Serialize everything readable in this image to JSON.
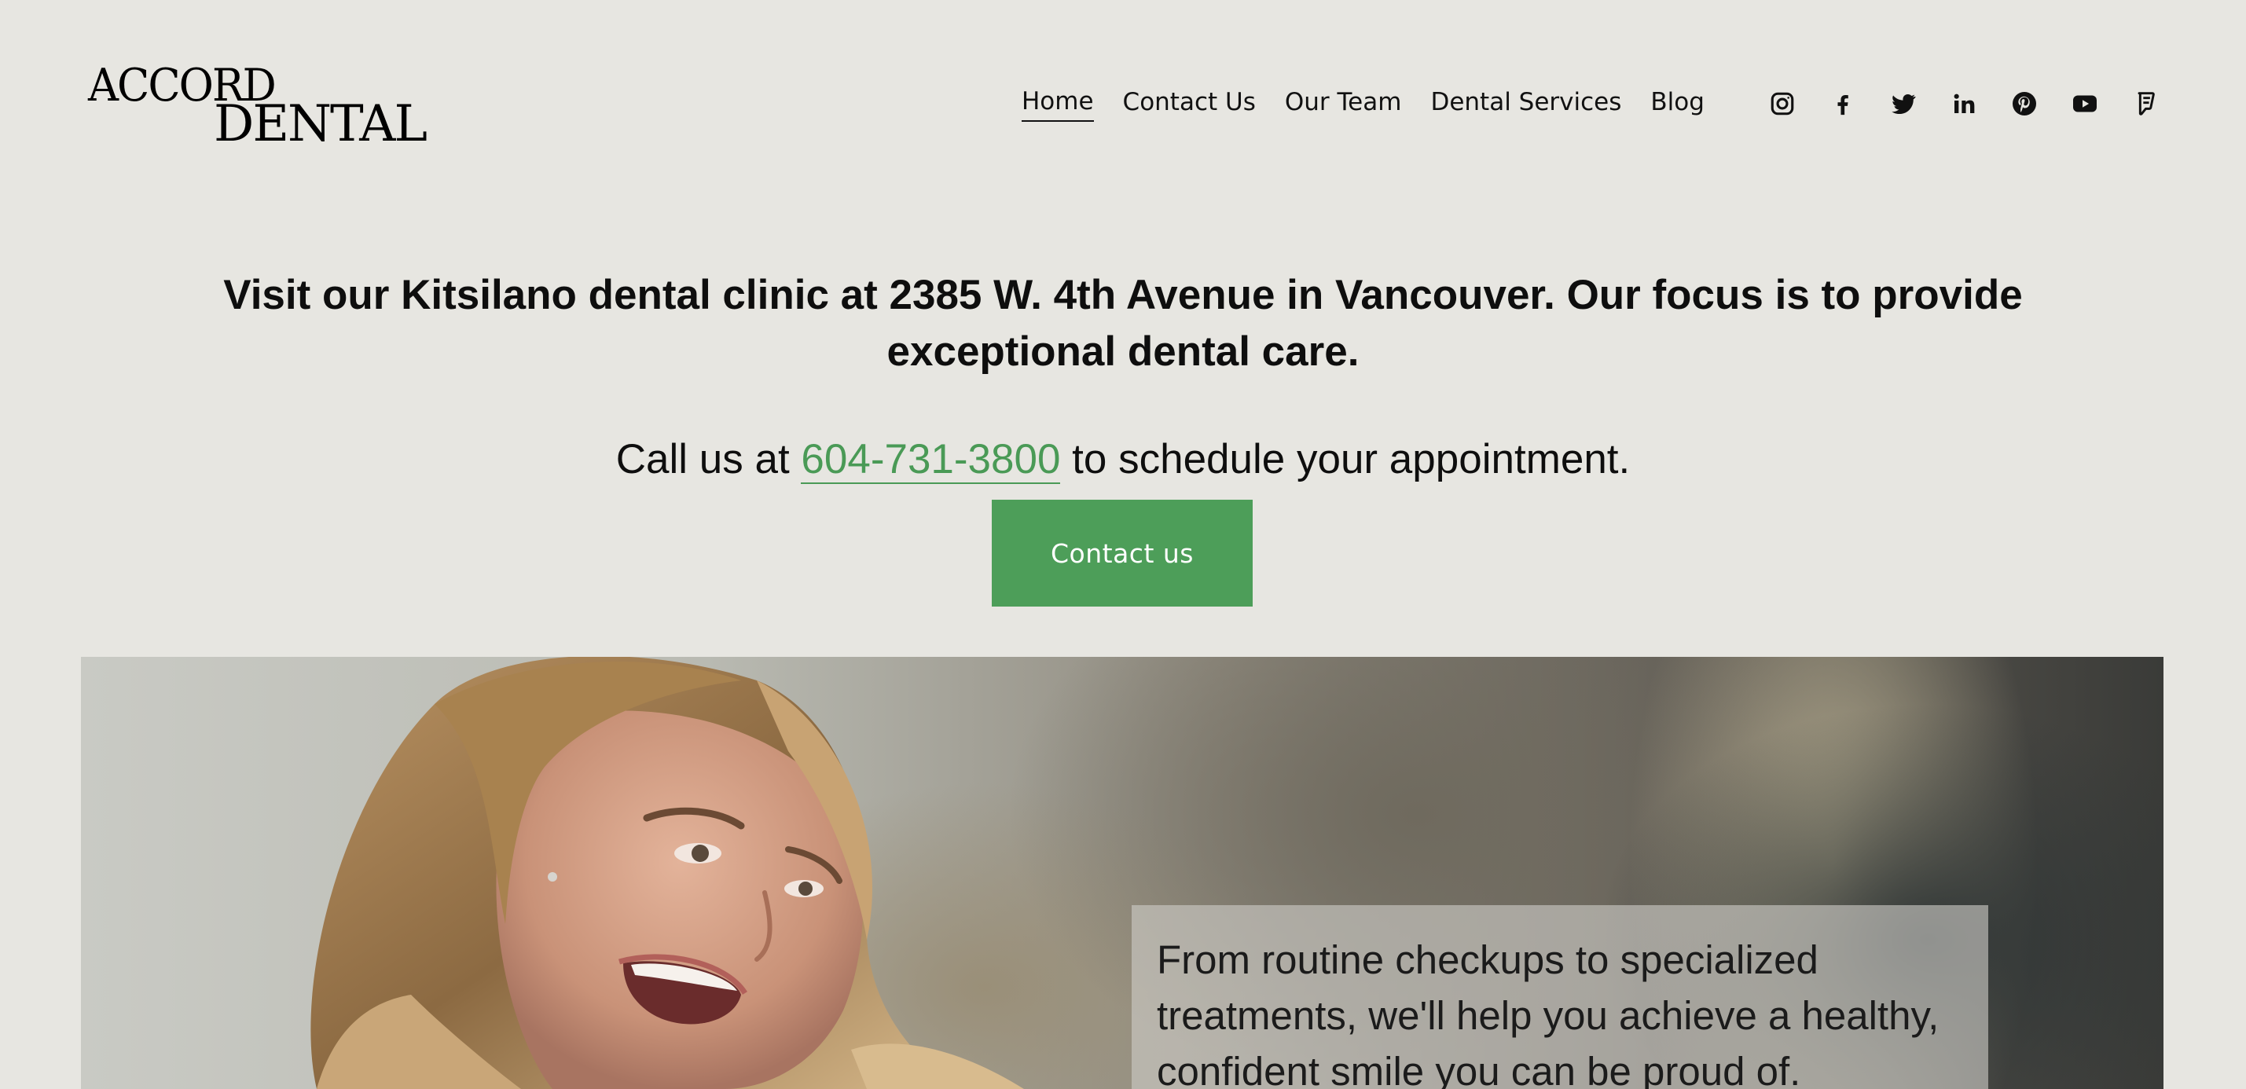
{
  "logo": {
    "line1": "ACCORD",
    "line2": "DENTAL"
  },
  "nav": {
    "items": [
      {
        "label": "Home",
        "active": true
      },
      {
        "label": "Contact Us",
        "active": false
      },
      {
        "label": "Our Team",
        "active": false
      },
      {
        "label": "Dental Services",
        "active": false
      },
      {
        "label": "Blog",
        "active": false
      }
    ]
  },
  "social": {
    "icons": [
      "instagram-icon",
      "facebook-icon",
      "twitter-icon",
      "linkedin-icon",
      "pinterest-icon",
      "youtube-icon",
      "foursquare-icon"
    ]
  },
  "hero": {
    "headline": "Visit our Kitsilano dental clinic at 2385 W. 4th Avenue in Vancouver. Our focus is to provide exceptional dental care.",
    "call_prefix": "Call us at ",
    "phone": "604-731-3800",
    "call_suffix": " to schedule your appointment.",
    "cta_label": "Contact us"
  },
  "banner": {
    "overlay_text": "From routine checkups to specialized treatments, we'll help you achieve a healthy, confident smile you can be proud of."
  },
  "colors": {
    "background": "#e7e6e1",
    "accent": "#4d9e59",
    "text": "#111111"
  }
}
